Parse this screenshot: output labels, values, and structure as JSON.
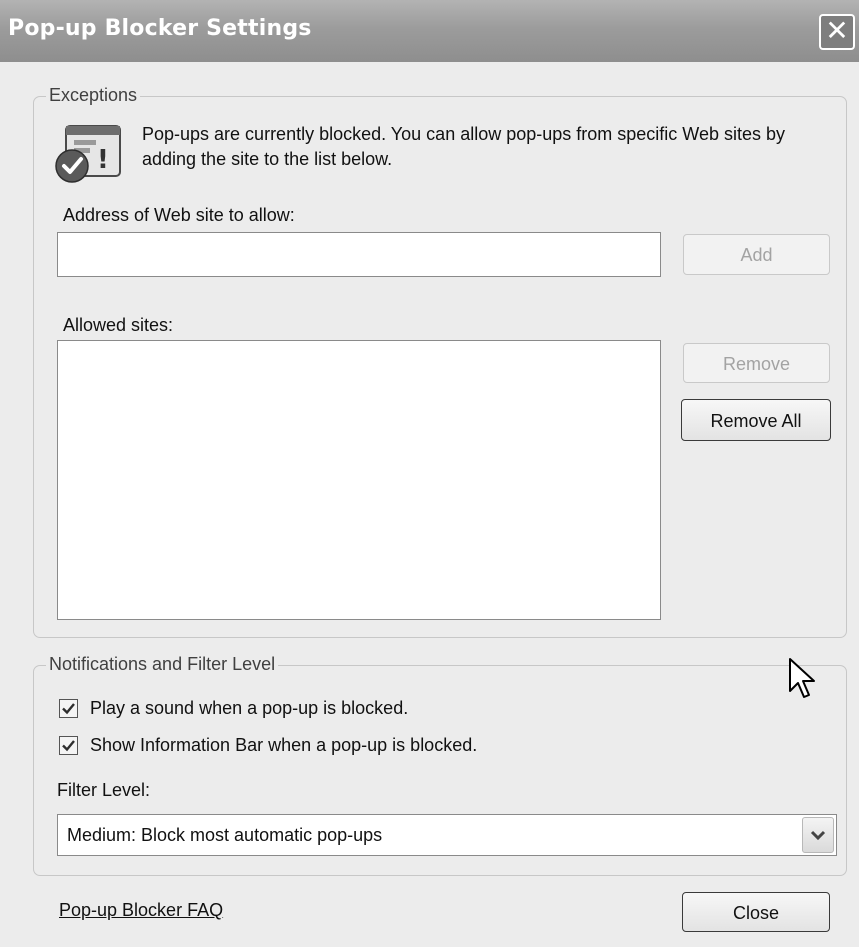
{
  "window": {
    "title": "Pop-up Blocker Settings",
    "close_glyph": "✕"
  },
  "exceptions": {
    "legend": "Exceptions",
    "icon": "info-window-icon",
    "info_text": "Pop-ups are currently blocked.  You can allow pop-ups from specific Web sites by adding the site to the list below.",
    "address_label": "Address of Web site to allow:",
    "address_value": "",
    "add_label": "Add",
    "allowed_label": "Allowed sites:",
    "allowed_sites": [],
    "remove_label": "Remove",
    "remove_all_label": "Remove All"
  },
  "notifications": {
    "legend": "Notifications and Filter Level",
    "play_sound_label": "Play a sound when a pop-up is blocked.",
    "play_sound_checked": true,
    "show_bar_label": "Show Information Bar when a pop-up is blocked.",
    "show_bar_checked": true,
    "filter_level_label": "Filter Level:",
    "filter_level_value": "Medium: Block most automatic pop-ups"
  },
  "footer": {
    "faq_link": "Pop-up Blocker FAQ",
    "close_label": "Close"
  },
  "colors": {
    "title_bar": "#9c9c9c",
    "dialog_bg": "#ececec"
  }
}
